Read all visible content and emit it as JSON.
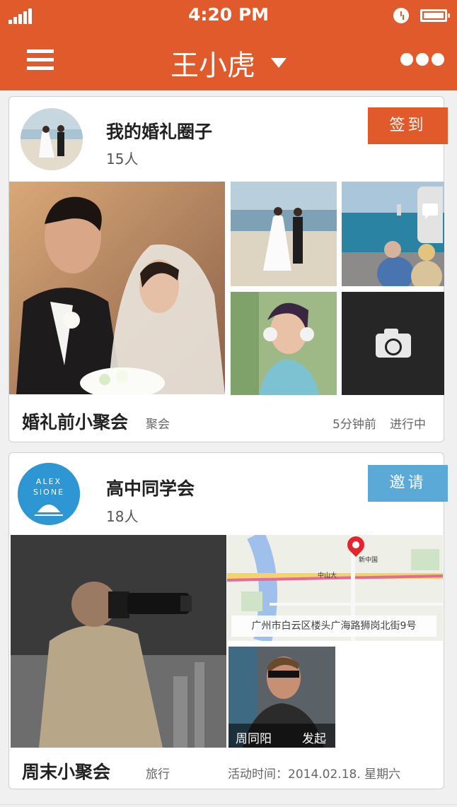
{
  "status_bar": {
    "time": "4:20 PM",
    "signal_icon": "signal-bars-icon",
    "alarm_icon": "clock-icon",
    "battery_icon": "battery-full-icon"
  },
  "header": {
    "title": "王小虎",
    "menu_icon": "hamburger-menu-icon",
    "dropdown_icon": "caret-down-icon",
    "more_icon": "more-dots-icon"
  },
  "colors": {
    "header": "#e05a2b",
    "checkin_button": "#e05a2b",
    "invite_button": "#5aa9d6"
  },
  "groups": [
    {
      "name": "我的婚礼圈子",
      "count": "15人",
      "button": "签到",
      "event_title": "婚礼前小聚会",
      "event_type": "聚会",
      "event_time": "5分钟前",
      "event_status": "进行中"
    },
    {
      "name": "高中同学会",
      "count": "18人",
      "button": "邀请",
      "avatar_text_1": "ALEX",
      "avatar_text_2": "SIONE",
      "event_title": "周末小聚会",
      "event_type": "旅行",
      "event_time": "活动时间：2014.02.18.  星期六",
      "map": {
        "address": "广州市白云区楼头广海路狮岗北街9号",
        "label_1": "中山大",
        "label_2": "新中国"
      },
      "initiator_name": "周同阳",
      "initiator_action": "发起"
    }
  ]
}
